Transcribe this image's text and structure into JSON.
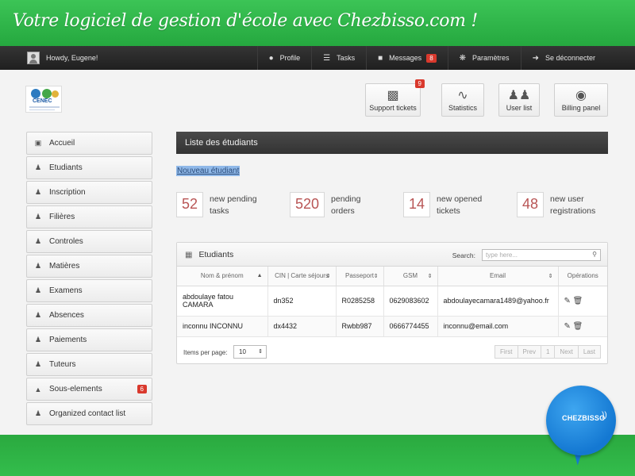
{
  "banner": {
    "title": "Votre logiciel de gestion d'école avec Chezbisso.com !"
  },
  "topbar": {
    "greeting": "Howdy, Eugene!",
    "nav": [
      {
        "icon": "user-icon",
        "label": "Profile"
      },
      {
        "icon": "list-icon",
        "label": "Tasks"
      },
      {
        "icon": "comments-icon",
        "label": "Messages",
        "badge": "8"
      },
      {
        "icon": "gear-icon",
        "label": "Paramètres"
      },
      {
        "icon": "logout-icon",
        "label": "Se déconnecter"
      }
    ]
  },
  "logo": {
    "text": "CENEC"
  },
  "quick": [
    {
      "icon": "support-icon",
      "label": "Support tickets",
      "badge": "9"
    },
    {
      "icon": "chart-icon",
      "label": "Statistics"
    },
    {
      "icon": "users-icon",
      "label": "User list"
    },
    {
      "icon": "money-icon",
      "label": "Billing panel"
    }
  ],
  "sidebar": {
    "items": [
      {
        "icon": "home-icon",
        "label": "Accueil"
      },
      {
        "icon": "user-icon",
        "label": "Etudiants"
      },
      {
        "icon": "user-icon",
        "label": "Inscription"
      },
      {
        "icon": "user-icon",
        "label": "Filières"
      },
      {
        "icon": "user-icon",
        "label": "Controles"
      },
      {
        "icon": "user-icon",
        "label": "Matières"
      },
      {
        "icon": "user-icon",
        "label": "Examens"
      },
      {
        "icon": "user-icon",
        "label": "Absences"
      },
      {
        "icon": "user-icon",
        "label": "Paiements"
      },
      {
        "icon": "user-icon",
        "label": "Tuteurs"
      },
      {
        "icon": "warning-icon",
        "label": "Sous-elements",
        "badge": "6"
      },
      {
        "icon": "group-icon",
        "label": "Organized contact list"
      }
    ]
  },
  "main": {
    "header": "Liste des étudiants",
    "new_link": "Nouveau étudiant",
    "stats": [
      {
        "value": "52",
        "line1": "new pending",
        "line2": "tasks"
      },
      {
        "value": "520",
        "line1": "pending",
        "line2": "orders"
      },
      {
        "value": "14",
        "line1": "new opened",
        "line2": "tickets"
      },
      {
        "value": "48",
        "line1": "new user",
        "line2": "registrations"
      }
    ]
  },
  "table": {
    "title": "Etudiants",
    "search_label": "Search:",
    "search_placeholder": "type here...",
    "columns": [
      "Nom & prénom",
      "CIN | Carte séjours",
      "Passeport",
      "GSM",
      "Email",
      "Opérations"
    ],
    "rows": [
      {
        "name": "abdoulaye fatou CAMARA",
        "cin": "dn352",
        "passport": "R0285258",
        "gsm": "0629083602",
        "email": "abdoulayecamara1489@yahoo.fr"
      },
      {
        "name": "inconnu INCONNU",
        "cin": "dx4432",
        "passport": "Rwbb987",
        "gsm": "0666774455",
        "email": "inconnu@email.com"
      }
    ],
    "items_per_page_label": "Items per page:",
    "items_per_page": "10",
    "pager": [
      "First",
      "Prev",
      "1",
      "Next",
      "Last"
    ]
  },
  "brand": {
    "bubble": "CHEZBISSO"
  },
  "colors": {
    "green": "#2fb34a",
    "dark": "#333333",
    "badge": "#d9392d",
    "bubble": "#1478d2"
  }
}
